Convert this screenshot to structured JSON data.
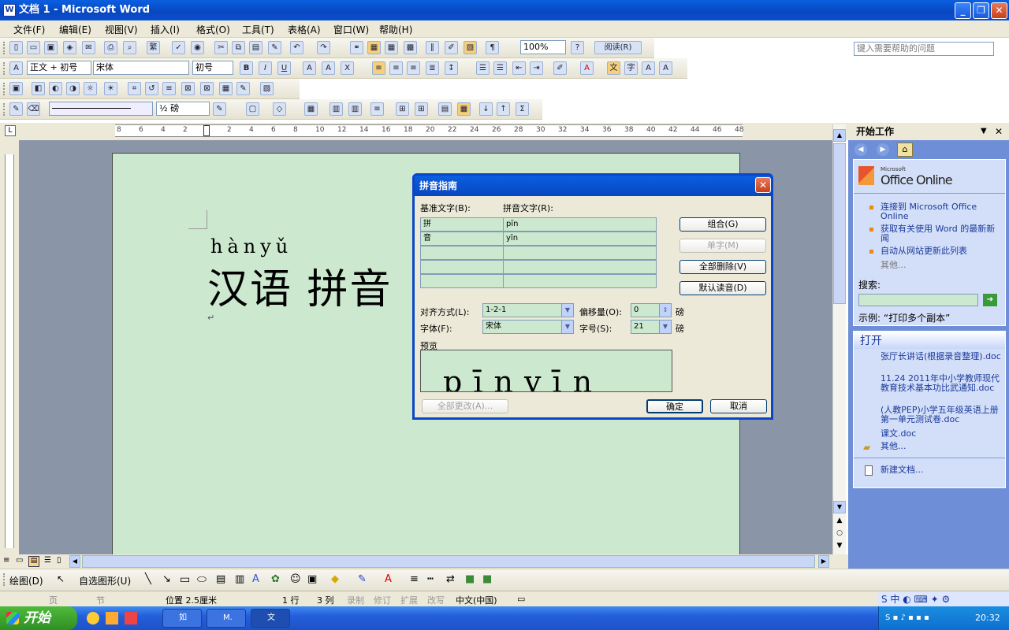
{
  "window": {
    "title": "文档 1 - Microsoft Word",
    "help_placeholder": "键入需要帮助的问题"
  },
  "menu": [
    "文件(F)",
    "编辑(E)",
    "视图(V)",
    "插入(I)",
    "格式(O)",
    "工具(T)",
    "表格(A)",
    "窗口(W)",
    "帮助(H)"
  ],
  "toolbar": {
    "zoom": "100%",
    "read": "阅读(R)",
    "style": "正文 + 初号",
    "font": "宋体",
    "size": "初号",
    "line_weight": "½ 磅"
  },
  "document": {
    "pinyin": "hànyǔ",
    "hanzi": "汉语 拼音",
    "para_mark": "↵"
  },
  "ruler": {
    "numbers": [
      "8",
      "6",
      "4",
      "2",
      "2",
      "4",
      "6",
      "8",
      "10",
      "12",
      "14",
      "16",
      "18",
      "20",
      "22",
      "24",
      "26",
      "28",
      "30",
      "32",
      "34",
      "36",
      "38",
      "40",
      "42",
      "44",
      "46",
      "48"
    ]
  },
  "dialog": {
    "title": "拼音指南",
    "base_label": "基准文字(B):",
    "ruby_label": "拼音文字(R):",
    "rows": [
      {
        "base": "拼",
        "ruby": "pīn"
      },
      {
        "base": "音",
        "ruby": "yīn"
      },
      {
        "base": "",
        "ruby": ""
      },
      {
        "base": "",
        "ruby": ""
      },
      {
        "base": "",
        "ruby": ""
      }
    ],
    "btn_group": "组合(G)",
    "btn_single": "单字(M)",
    "btn_clear": "全部删除(V)",
    "btn_default": "默认读音(D)",
    "align_label": "对齐方式(L):",
    "align_value": "1-2-1",
    "offset_label": "偏移量(O):",
    "offset_value": "0",
    "offset_unit": "磅",
    "font_label": "字体(F):",
    "font_value": "宋体",
    "size_label": "字号(S):",
    "size_value": "21",
    "size_unit": "磅",
    "preview_label": "预览",
    "preview_text": "pīnyīn",
    "btn_apply_all": "全部更改(A)...",
    "btn_ok": "确定",
    "btn_cancel": "取消"
  },
  "taskpane": {
    "title": "开始工作",
    "brand_small": "Microsoft",
    "brand": "Office Online",
    "links": [
      "连接到 Microsoft Office Online",
      "获取有关使用 Word 的最新新闻",
      "自动从网站更新此列表"
    ],
    "other": "其他...",
    "search_label": "搜索:",
    "example": "示例:  “打印多个副本”",
    "open_title": "打开",
    "files": [
      "张厅长讲话(根据录音整理).doc",
      "11.24 2011年中小学教师现代教育技术基本功比武通知.doc",
      "(人教PEP)小学五年级英语上册第一单元测试卷.doc",
      "课文.doc"
    ],
    "more": "其他...",
    "new_doc": "新建文档..."
  },
  "drawbar": {
    "draw": "绘图(D)",
    "autoshape": "自选图形(U)"
  },
  "status": {
    "page": "页",
    "section": "节",
    "position": "位置 2.5厘米",
    "line": "1 行",
    "col": "3 列",
    "rec": "录制",
    "trk": "修订",
    "ext": "扩展",
    "ovr": "改写",
    "lang": "中文(中国)"
  },
  "taskbar": {
    "start": "开始",
    "tasks": [
      "如",
      "M.",
      "文"
    ],
    "clock": "20:32"
  }
}
